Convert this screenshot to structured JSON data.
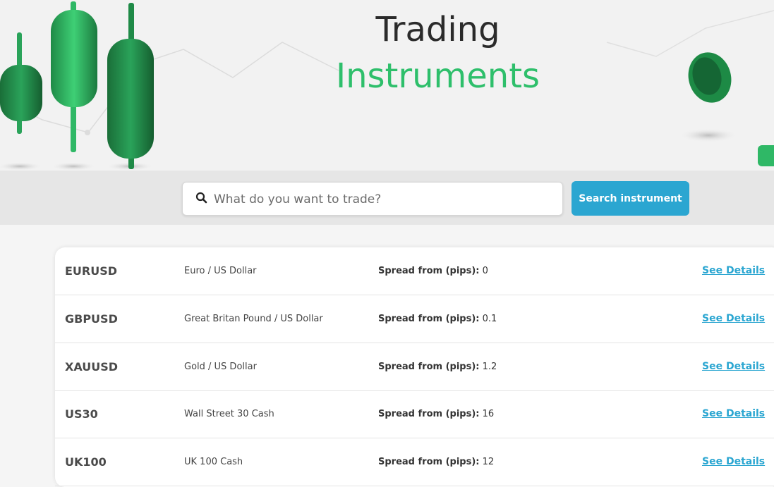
{
  "hero": {
    "title_line1": "Trading",
    "title_line2": "Instruments",
    "title_color": "#2b2b2b",
    "accent_color": "#2ebf6b"
  },
  "search": {
    "placeholder": "What do you want to trade?",
    "value": "",
    "icon": "search-icon",
    "button_label": "Search instrument",
    "button_color": "#2ba6d1"
  },
  "instruments": {
    "spread_label": "Spread from (pips):",
    "details_label": "See Details",
    "rows": [
      {
        "symbol": "EURUSD",
        "name": "Euro / US Dollar",
        "spread": "0"
      },
      {
        "symbol": "GBPUSD",
        "name": "Great Britan Pound / US Dollar",
        "spread": "0.1"
      },
      {
        "symbol": "XAUUSD",
        "name": "Gold / US Dollar",
        "spread": "1.2"
      },
      {
        "symbol": "US30",
        "name": "Wall Street 30 Cash",
        "spread": "16"
      },
      {
        "symbol": "UK100",
        "name": "UK 100 Cash",
        "spread": "12"
      }
    ]
  }
}
